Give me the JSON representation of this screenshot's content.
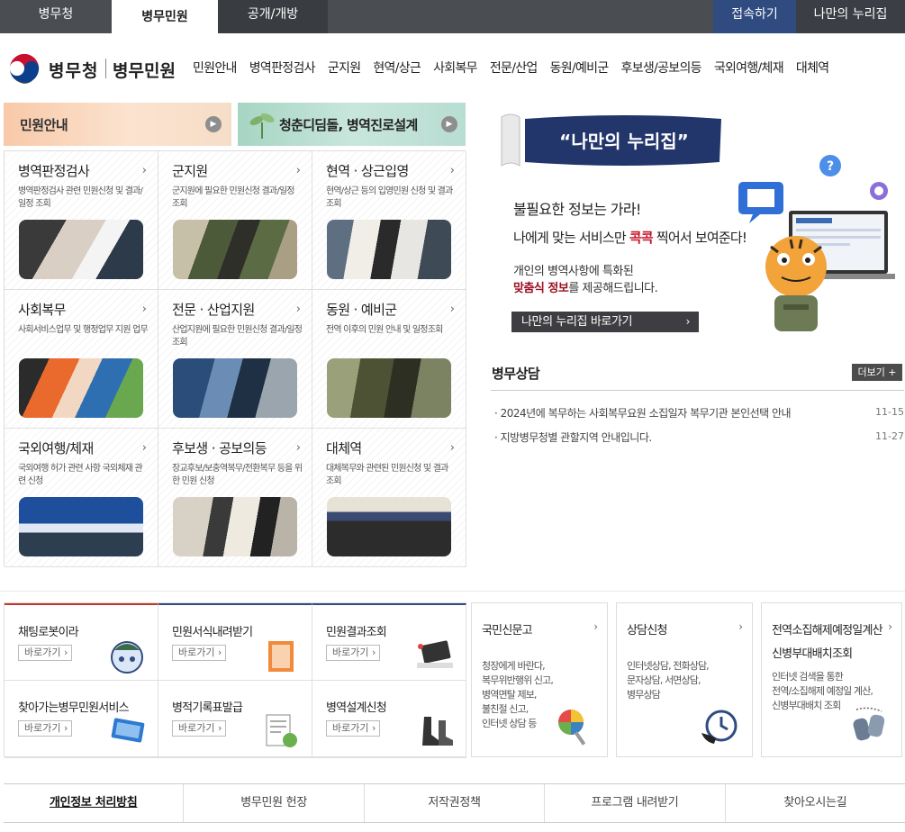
{
  "topbar": {
    "tabs": [
      "병무청",
      "병무민원",
      "공개/개방"
    ],
    "login": "접속하기",
    "my_nuri": "나만의 누리집"
  },
  "header": {
    "org_name": "병무청",
    "site_name": "병무민원",
    "nav": [
      "민원안내",
      "병역판정검사",
      "군지원",
      "현역/상근",
      "사회복무",
      "전문/산업",
      "동원/예비군",
      "후보생/공보의등",
      "국외여행/체재",
      "대체역"
    ]
  },
  "banners": {
    "left": "민원안내",
    "right": "청춘디딤돌, 병역진로설계"
  },
  "services": [
    {
      "title": "병역판정검사",
      "desc": "병역판정검사 관련 민원신청 및 결과/일정 조회"
    },
    {
      "title": "군지원",
      "desc": "군지원에 필요한 민원신청 결과/일정 조회"
    },
    {
      "title": "현역 · 상근입영",
      "desc": "현역/상근 등의 입영민원 신청 및 결과 조회"
    },
    {
      "title": "사회복무",
      "desc": "사회서비스업무 및 행정업무 지원 업무"
    },
    {
      "title": "전문 · 산업지원",
      "desc": "산업지원에 필요한 민원신청 결과/일정 조회"
    },
    {
      "title": "동원 · 예비군",
      "desc": "전역 이후의 민원 안내 및 일정조회"
    },
    {
      "title": "국외여행/체재",
      "desc": "국외여행 허가 관련 사항 국외체재 관련 신청"
    },
    {
      "title": "후보생 · 공보의등",
      "desc": "장교후보/보충역복무/전환복무 등을 위한 민원 신청"
    },
    {
      "title": "대체역",
      "desc": "대체복무와 관련된 민원신청 및 결과 조회"
    }
  ],
  "promo": {
    "banner": "“나만의 누리집”",
    "line1": "불필요한 정보는 가라!",
    "line2_pre": "나에게 맞는 서비스만 ",
    "line2_highlight": "콕콕",
    "line2_post": " 찍어서 보여준다!",
    "line3": "개인의 병역사항에 특화된",
    "line4_highlight": "맞춤식 정보",
    "line4_post": "를 제공해드립니다.",
    "button": "나만의 누리집 바로가기"
  },
  "counsel": {
    "title": "병무상담",
    "more": "더보기 +",
    "items": [
      {
        "text": "· 2024년에 복무하는 사회복무요원 소집일자 복무기관 본인선택 안내",
        "date": "11-15"
      },
      {
        "text": "· 지방병무청별 관할지역 안내입니다.",
        "date": "11-27"
      }
    ]
  },
  "quick": [
    {
      "title": "채팅로봇이라",
      "btn": "바로가기 ›"
    },
    {
      "title": "민원서식내려받기",
      "btn": "바로가기 ›"
    },
    {
      "title": "민원결과조회",
      "btn": "바로가기 ›"
    },
    {
      "title": "찾아가는병무민원서비스",
      "btn": "바로가기 ›"
    },
    {
      "title": "병적기록표발급",
      "btn": "바로가기 ›"
    },
    {
      "title": "병역설계신청",
      "btn": "바로가기 ›"
    }
  ],
  "big": [
    {
      "title": "국민신문고",
      "lines": [
        "청장에게 바란다,",
        "복무위반행위 신고,",
        "병역면탈 제보,",
        "불친절 신고,",
        "인터넷 상담 등"
      ]
    },
    {
      "title": "상담신청",
      "lines": [
        "인터넷상담, 전화상담,",
        "문자상담, 서면상담,",
        "병무상담"
      ]
    },
    {
      "title": "전역소집해제예정일계산",
      "title2": "신병부대배치조회",
      "lines": [
        "인터넷 검색을 통한",
        "전역/소집해제 예정일 계산,",
        "신병부대배치 조회"
      ]
    }
  ],
  "footer": [
    "개인정보 처리방침",
    "병무민원 헌장",
    "저작권정책",
    "프로그램 내려받기",
    "찾아오시는길"
  ],
  "colors": {
    "accent_navy": "#2f4b80",
    "highlight_red": "#c7162b"
  }
}
